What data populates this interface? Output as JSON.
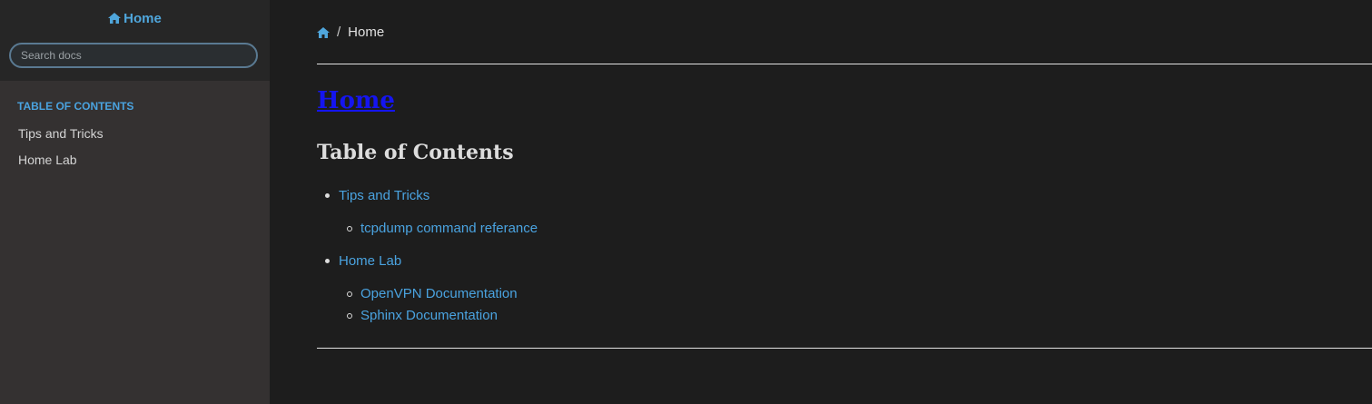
{
  "sidebar": {
    "home_label": "Home",
    "search_placeholder": "Search docs",
    "toc_caption": "TABLE OF CONTENTS",
    "items": [
      {
        "label": "Tips and Tricks"
      },
      {
        "label": "Home Lab"
      }
    ]
  },
  "breadcrumb": {
    "separator": "/",
    "current": "Home"
  },
  "main": {
    "title": "Home",
    "toc_heading": "Table of Contents",
    "toc": [
      {
        "label": "Tips and Tricks",
        "children": [
          {
            "label": "tcpdump command referance"
          }
        ]
      },
      {
        "label": "Home Lab",
        "children": [
          {
            "label": "OpenVPN Documentation"
          },
          {
            "label": "Sphinx Documentation"
          }
        ]
      }
    ]
  },
  "colors": {
    "link": "#4aa3e0",
    "title": "#1515f0",
    "sidebar_bg": "#343131",
    "content_bg": "#1d1d1d"
  },
  "icons": {
    "home": "home-icon"
  }
}
